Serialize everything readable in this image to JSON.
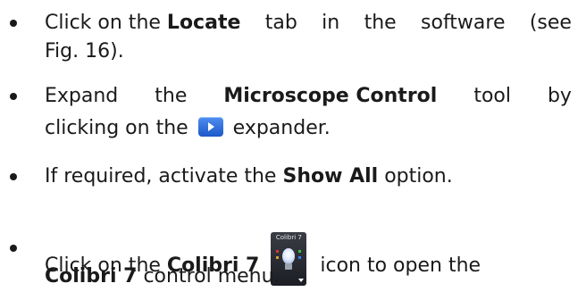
{
  "steps": [
    {
      "line1": [
        "Click on the",
        "Locate",
        "tab",
        "in",
        "the",
        "software",
        "(see"
      ],
      "line2": "Fig. 16)."
    },
    {
      "line1": [
        "Expand",
        "the",
        "Microscope Control",
        "tool",
        "by"
      ],
      "line2": {
        "before": "clicking on the",
        "after": "expander."
      }
    },
    {
      "text": {
        "before": "If required, activate the",
        "bold": "Show All",
        "after": "option."
      }
    },
    {
      "line1": {
        "before": "Click on the",
        "bold": "Colibri 7",
        "after": "icon to open the"
      },
      "line2": {
        "bold": "Colibri 7",
        "after": "control menu."
      }
    }
  ],
  "icons": {
    "expander": "expander-icon",
    "colibri": "colibri-7-icon",
    "colibri_label": "Colibri 7"
  },
  "colors": {
    "text": "#1a1a1a",
    "expander_blue": "#2f6fe0"
  }
}
